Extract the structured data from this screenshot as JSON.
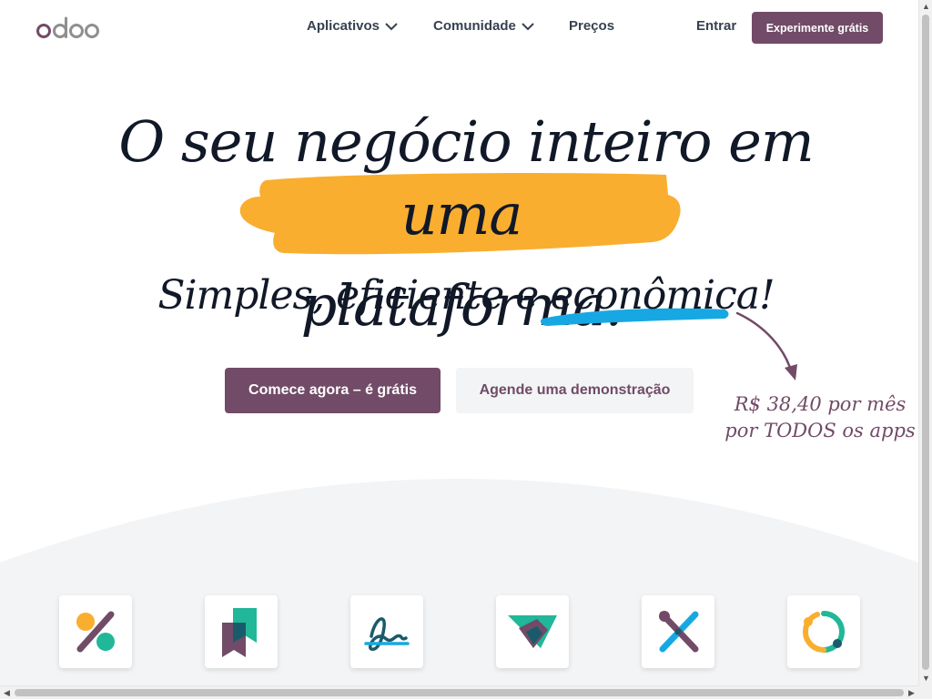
{
  "nav": {
    "logo_text": "odoo",
    "items": [
      {
        "label": "Aplicativos",
        "has_dropdown": true
      },
      {
        "label": "Comunidade",
        "has_dropdown": true
      },
      {
        "label": "Preços",
        "has_dropdown": false
      }
    ],
    "login_label": "Entrar",
    "cta_label": "Experimente grátis"
  },
  "hero": {
    "headline_line1": "O seu negócio inteiro em",
    "headline_line2": "uma plataforma.",
    "subtitle": "Simples, eficiente e econômica!",
    "primary_cta": "Comece agora – é grátis",
    "secondary_cta": "Agende uma demonstração",
    "price_note_line1": "R$ 38,40 por mês",
    "price_note_line2": "por TODOS os apps"
  },
  "apps": [
    {
      "icon": "accounting-icon"
    },
    {
      "icon": "knowledge-icon"
    },
    {
      "icon": "sign-icon"
    },
    {
      "icon": "crm-icon"
    },
    {
      "icon": "studio-icon"
    },
    {
      "icon": "discuss-icon"
    }
  ],
  "colors": {
    "brand": "#714b67",
    "highlight": "#f9ae2f",
    "underline": "#17a8e3",
    "teal": "#21b799"
  }
}
